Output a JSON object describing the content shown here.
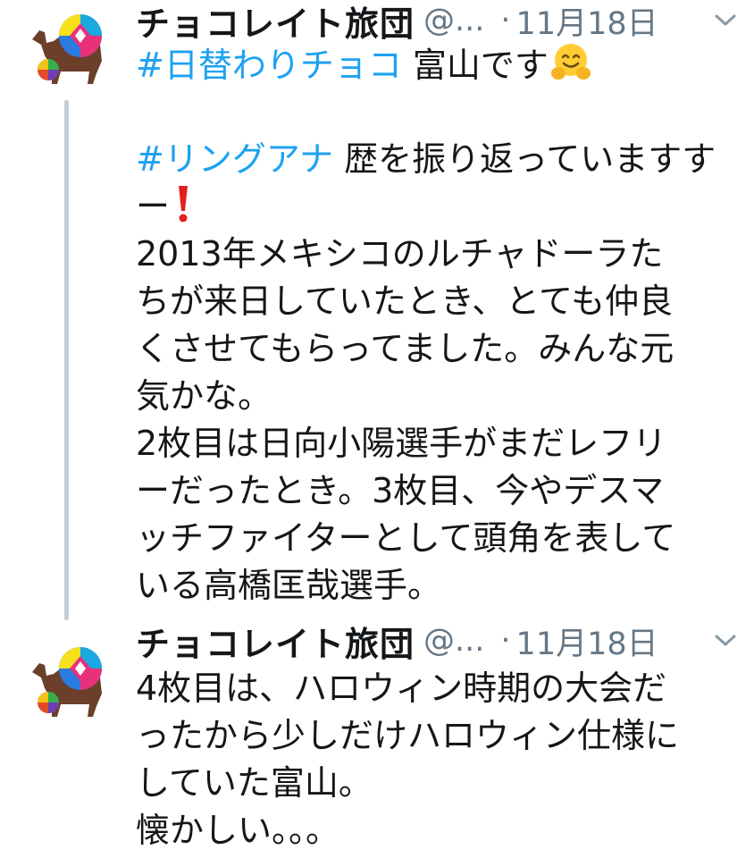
{
  "tweets": [
    {
      "author_name": "チョコレイト旅団",
      "handle": "@...",
      "separator": "·",
      "date": "11月18日",
      "line1_hashtag": "#日替わりチョコ",
      "line1_text": " 富山です",
      "line1_emoji": "hugging-face-icon",
      "line2_hashtag": "#リングアナ",
      "line2_text": " 歴を振り返っていますす",
      "line3_text": "ー",
      "line3_emoji": "exclamation-icon",
      "lines": [
        "2013年メキシコのルチャドーラた",
        "ちが来日していたとき、とても仲良",
        "くさせてもらってました。みんな元",
        "気かな。",
        "2枚目は日向小陽選手がまだレフリ",
        "ーだったとき。3枚目、今やデスマ",
        "ッチファイターとして頭角を表して",
        "いる高橋匡哉選手。"
      ]
    },
    {
      "author_name": "チョコレイト旅団",
      "handle": "@...",
      "separator": "·",
      "date": "11月18日",
      "lines": [
        "4枚目は、ハロウィン時期の大会だ",
        "ったから少しだけハロウィン仕様に",
        "していた富山。",
        "懐かしい。。。"
      ]
    }
  ],
  "colors": {
    "hashtag": "#1da1f2",
    "meta": "#657786",
    "thread_line": "#c4cfd6"
  }
}
